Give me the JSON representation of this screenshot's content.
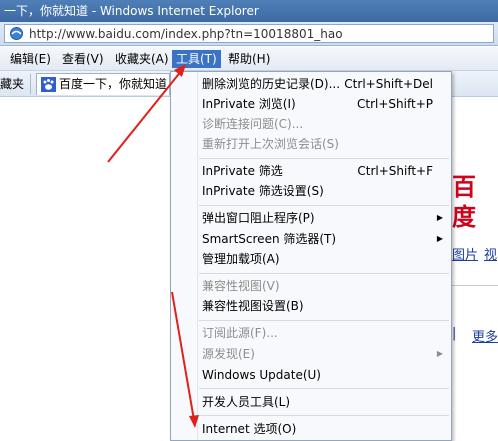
{
  "window": {
    "title": "一下，你就知道 - Windows Internet Explorer"
  },
  "address": {
    "url": "http://www.baidu.com/index.php?tn=10018801_hao"
  },
  "menubar": {
    "items": [
      {
        "label": "编辑(E)"
      },
      {
        "label": "查看(V)"
      },
      {
        "label": "收藏夹(A)"
      },
      {
        "label": "工具(T)"
      },
      {
        "label": "帮助(H)"
      }
    ]
  },
  "favorites": {
    "left_label": "藏夹",
    "tab_title": "百度一下，你就知道"
  },
  "page": {
    "logo_fragment": "百度",
    "link1": "图片",
    "link2": "视",
    "link3": "更多"
  },
  "tools_menu": {
    "items": [
      {
        "label": "删除浏览的历史记录(D)...",
        "shortcut": "Ctrl+Shift+Del"
      },
      {
        "label": "InPrivate 浏览(I)",
        "shortcut": "Ctrl+Shift+P"
      },
      {
        "label": "诊断连接问题(C)..."
      },
      {
        "label": "重新打开上次浏览会话(S)"
      },
      {
        "label": "InPrivate 筛选",
        "shortcut": "Ctrl+Shift+F"
      },
      {
        "label": "InPrivate 筛选设置(S)"
      },
      {
        "label": "弹出窗口阻止程序(P)"
      },
      {
        "label": "SmartScreen 筛选器(T)"
      },
      {
        "label": "管理加载项(A)"
      },
      {
        "label": "兼容性视图(V)"
      },
      {
        "label": "兼容性视图设置(B)"
      },
      {
        "label": "订阅此源(F)..."
      },
      {
        "label": "源发现(E)"
      },
      {
        "label": "Windows Update(U)"
      },
      {
        "label": "开发人员工具(L)"
      },
      {
        "label": "Internet 选项(O)"
      }
    ]
  },
  "colors": {
    "menu_highlight": "#3b73c4",
    "annotation_arrow": "#e0201b",
    "logo_red": "#d0021b"
  }
}
